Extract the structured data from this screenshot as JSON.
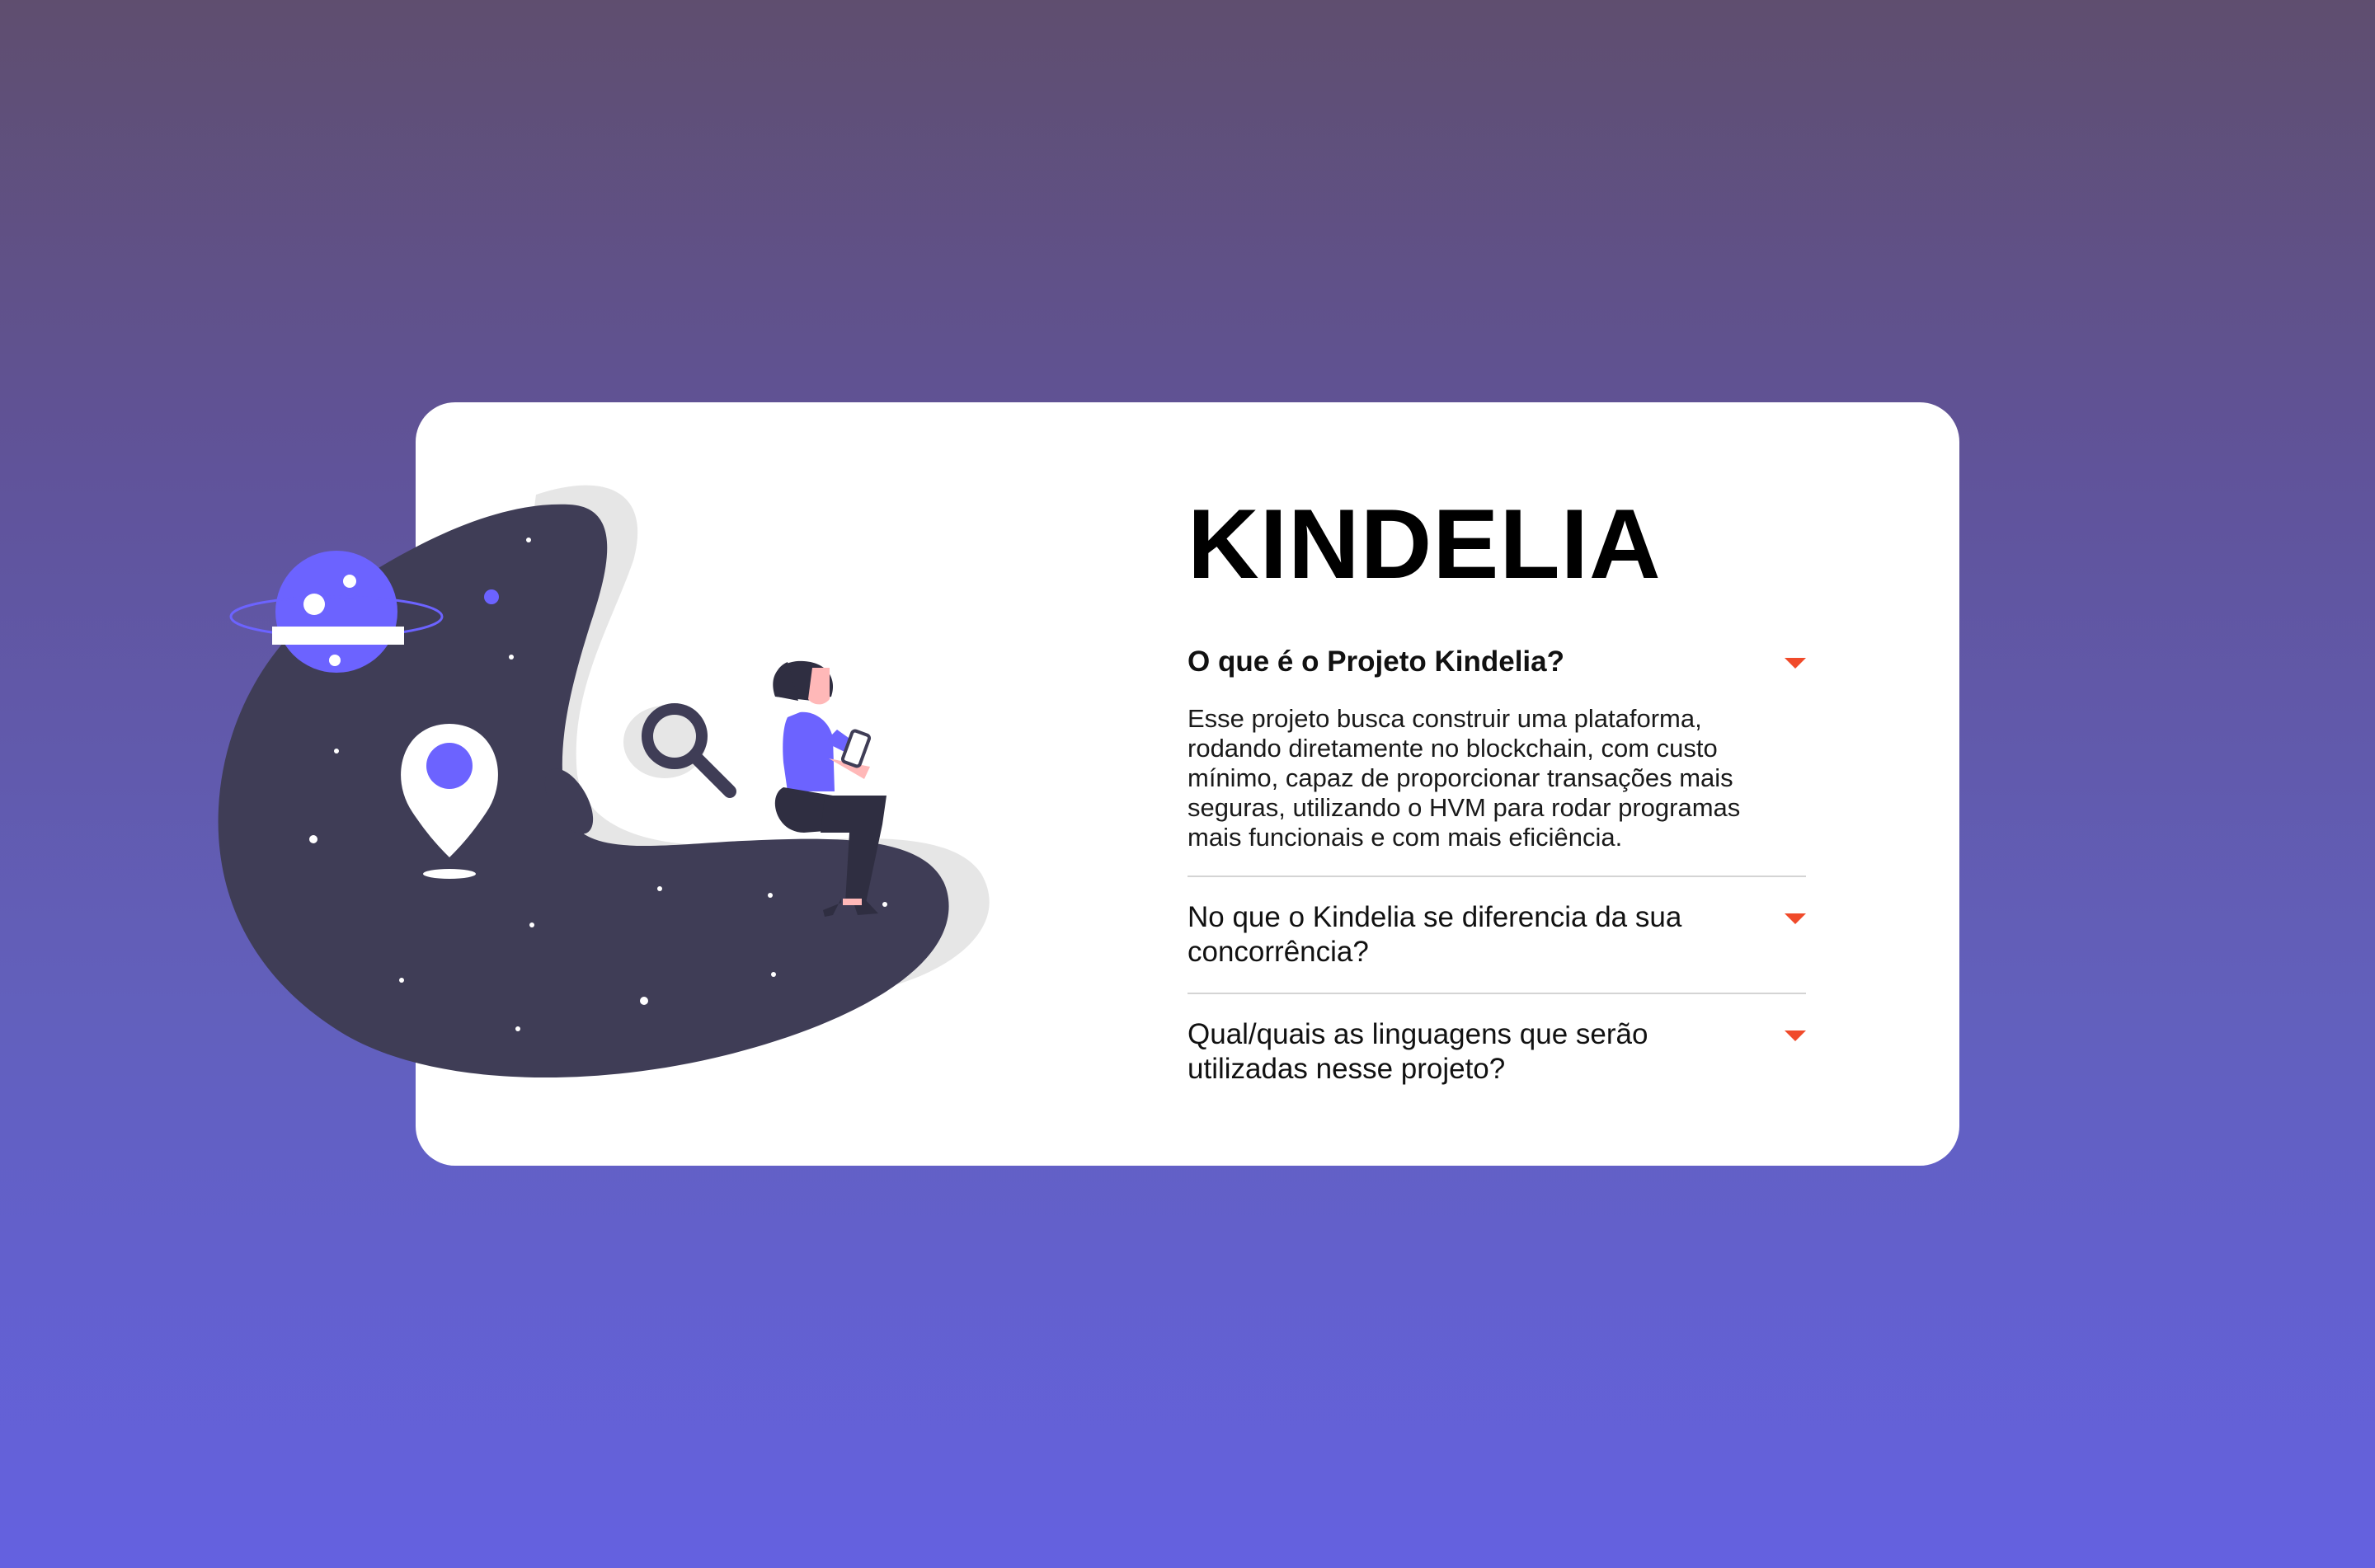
{
  "brand": {
    "title": "KINDELIA"
  },
  "faq": {
    "items": [
      {
        "question": "O que é o Projeto Kindelia?",
        "answer": "Esse projeto busca construir uma plataforma, rodando diretamente no blockchain, com custo mínimo, capaz de proporcionar transações mais seguras, utilizando o HVM para rodar programas mais funcionais e com mais eficiência.",
        "expanded": true
      },
      {
        "question": "No que o Kindelia se diferencia da sua concorrência?",
        "expanded": false
      },
      {
        "question": "Qual/quais as linguagens que serão utilizadas nesse projeto?",
        "expanded": false
      }
    ]
  },
  "colors": {
    "accent": "#f04a2a",
    "illustration_primary": "#6c63ff",
    "illustration_dark": "#3f3d56",
    "card_background": "#ffffff"
  },
  "icons": {
    "chevron": "chevron-down-icon",
    "illustration": "woman-reading-phone-space-illustration"
  }
}
